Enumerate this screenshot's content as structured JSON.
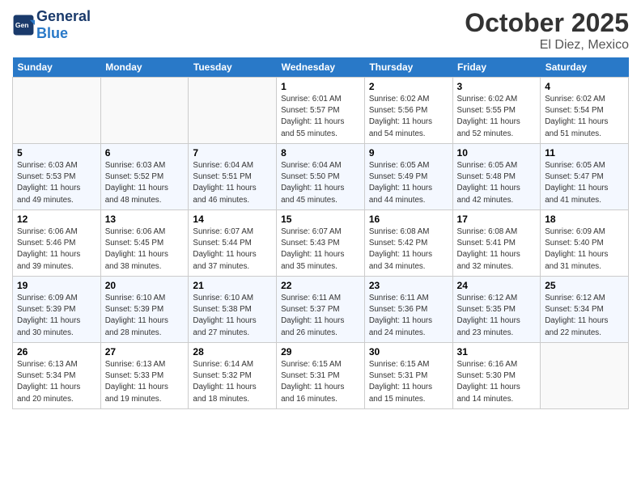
{
  "header": {
    "logo_general": "General",
    "logo_blue": "Blue",
    "month_title": "October 2025",
    "location": "El Diez, Mexico"
  },
  "days_of_week": [
    "Sunday",
    "Monday",
    "Tuesday",
    "Wednesday",
    "Thursday",
    "Friday",
    "Saturday"
  ],
  "weeks": [
    [
      {
        "day": "",
        "info": ""
      },
      {
        "day": "",
        "info": ""
      },
      {
        "day": "",
        "info": ""
      },
      {
        "day": "1",
        "info": "Sunrise: 6:01 AM\nSunset: 5:57 PM\nDaylight: 11 hours\nand 55 minutes."
      },
      {
        "day": "2",
        "info": "Sunrise: 6:02 AM\nSunset: 5:56 PM\nDaylight: 11 hours\nand 54 minutes."
      },
      {
        "day": "3",
        "info": "Sunrise: 6:02 AM\nSunset: 5:55 PM\nDaylight: 11 hours\nand 52 minutes."
      },
      {
        "day": "4",
        "info": "Sunrise: 6:02 AM\nSunset: 5:54 PM\nDaylight: 11 hours\nand 51 minutes."
      }
    ],
    [
      {
        "day": "5",
        "info": "Sunrise: 6:03 AM\nSunset: 5:53 PM\nDaylight: 11 hours\nand 49 minutes."
      },
      {
        "day": "6",
        "info": "Sunrise: 6:03 AM\nSunset: 5:52 PM\nDaylight: 11 hours\nand 48 minutes."
      },
      {
        "day": "7",
        "info": "Sunrise: 6:04 AM\nSunset: 5:51 PM\nDaylight: 11 hours\nand 46 minutes."
      },
      {
        "day": "8",
        "info": "Sunrise: 6:04 AM\nSunset: 5:50 PM\nDaylight: 11 hours\nand 45 minutes."
      },
      {
        "day": "9",
        "info": "Sunrise: 6:05 AM\nSunset: 5:49 PM\nDaylight: 11 hours\nand 44 minutes."
      },
      {
        "day": "10",
        "info": "Sunrise: 6:05 AM\nSunset: 5:48 PM\nDaylight: 11 hours\nand 42 minutes."
      },
      {
        "day": "11",
        "info": "Sunrise: 6:05 AM\nSunset: 5:47 PM\nDaylight: 11 hours\nand 41 minutes."
      }
    ],
    [
      {
        "day": "12",
        "info": "Sunrise: 6:06 AM\nSunset: 5:46 PM\nDaylight: 11 hours\nand 39 minutes."
      },
      {
        "day": "13",
        "info": "Sunrise: 6:06 AM\nSunset: 5:45 PM\nDaylight: 11 hours\nand 38 minutes."
      },
      {
        "day": "14",
        "info": "Sunrise: 6:07 AM\nSunset: 5:44 PM\nDaylight: 11 hours\nand 37 minutes."
      },
      {
        "day": "15",
        "info": "Sunrise: 6:07 AM\nSunset: 5:43 PM\nDaylight: 11 hours\nand 35 minutes."
      },
      {
        "day": "16",
        "info": "Sunrise: 6:08 AM\nSunset: 5:42 PM\nDaylight: 11 hours\nand 34 minutes."
      },
      {
        "day": "17",
        "info": "Sunrise: 6:08 AM\nSunset: 5:41 PM\nDaylight: 11 hours\nand 32 minutes."
      },
      {
        "day": "18",
        "info": "Sunrise: 6:09 AM\nSunset: 5:40 PM\nDaylight: 11 hours\nand 31 minutes."
      }
    ],
    [
      {
        "day": "19",
        "info": "Sunrise: 6:09 AM\nSunset: 5:39 PM\nDaylight: 11 hours\nand 30 minutes."
      },
      {
        "day": "20",
        "info": "Sunrise: 6:10 AM\nSunset: 5:39 PM\nDaylight: 11 hours\nand 28 minutes."
      },
      {
        "day": "21",
        "info": "Sunrise: 6:10 AM\nSunset: 5:38 PM\nDaylight: 11 hours\nand 27 minutes."
      },
      {
        "day": "22",
        "info": "Sunrise: 6:11 AM\nSunset: 5:37 PM\nDaylight: 11 hours\nand 26 minutes."
      },
      {
        "day": "23",
        "info": "Sunrise: 6:11 AM\nSunset: 5:36 PM\nDaylight: 11 hours\nand 24 minutes."
      },
      {
        "day": "24",
        "info": "Sunrise: 6:12 AM\nSunset: 5:35 PM\nDaylight: 11 hours\nand 23 minutes."
      },
      {
        "day": "25",
        "info": "Sunrise: 6:12 AM\nSunset: 5:34 PM\nDaylight: 11 hours\nand 22 minutes."
      }
    ],
    [
      {
        "day": "26",
        "info": "Sunrise: 6:13 AM\nSunset: 5:34 PM\nDaylight: 11 hours\nand 20 minutes."
      },
      {
        "day": "27",
        "info": "Sunrise: 6:13 AM\nSunset: 5:33 PM\nDaylight: 11 hours\nand 19 minutes."
      },
      {
        "day": "28",
        "info": "Sunrise: 6:14 AM\nSunset: 5:32 PM\nDaylight: 11 hours\nand 18 minutes."
      },
      {
        "day": "29",
        "info": "Sunrise: 6:15 AM\nSunset: 5:31 PM\nDaylight: 11 hours\nand 16 minutes."
      },
      {
        "day": "30",
        "info": "Sunrise: 6:15 AM\nSunset: 5:31 PM\nDaylight: 11 hours\nand 15 minutes."
      },
      {
        "day": "31",
        "info": "Sunrise: 6:16 AM\nSunset: 5:30 PM\nDaylight: 11 hours\nand 14 minutes."
      },
      {
        "day": "",
        "info": ""
      }
    ]
  ]
}
